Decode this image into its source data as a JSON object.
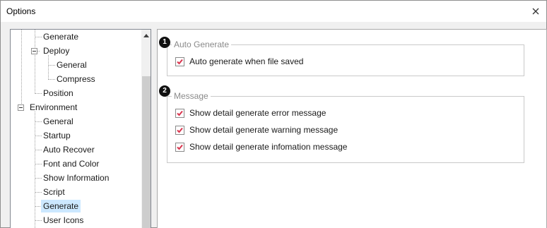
{
  "window": {
    "title": "Options"
  },
  "tree": {
    "items": [
      {
        "label": "Generate"
      },
      {
        "label": "Deploy"
      },
      {
        "label": "General"
      },
      {
        "label": "Compress"
      },
      {
        "label": "Position"
      },
      {
        "label": "Environment"
      },
      {
        "label": "General"
      },
      {
        "label": "Startup"
      },
      {
        "label": "Auto Recover"
      },
      {
        "label": "Font and Color"
      },
      {
        "label": "Show Information"
      },
      {
        "label": "Script"
      },
      {
        "label": "Generate"
      },
      {
        "label": "User Icons"
      }
    ],
    "selected_index": 12
  },
  "groups": {
    "auto_generate": {
      "badge": "1",
      "title": "Auto Generate",
      "options": [
        {
          "label": "Auto generate when file saved",
          "checked": true
        }
      ]
    },
    "message": {
      "badge": "2",
      "title": "Message",
      "options": [
        {
          "label": "Show detail generate error message",
          "checked": true
        },
        {
          "label": "Show detail generate warning message",
          "checked": true
        },
        {
          "label": "Show detail generate infomation message",
          "checked": true
        }
      ]
    }
  },
  "colors": {
    "check": "#d9364f",
    "selection": "#cce8ff"
  }
}
